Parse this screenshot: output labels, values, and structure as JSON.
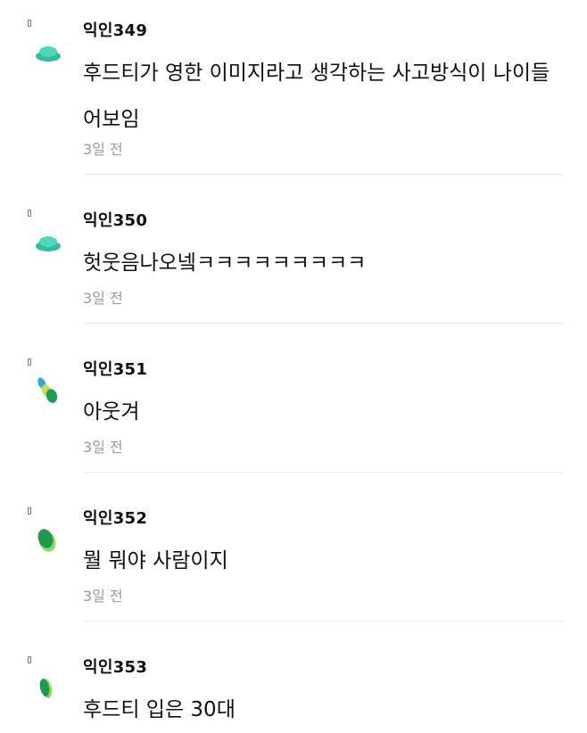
{
  "comments": [
    {
      "author": "익인349",
      "text": "후드티가 영한 이미지라고 생각하는 사고방식이 나이들어보임",
      "time": "3일 전",
      "avatar": "teal-disc-avatar"
    },
    {
      "author": "익인350",
      "text": "헛웃음나오넼ㅋㅋㅋㅋㅋㅋㅋㅋㅋ",
      "time": "3일 전",
      "avatar": "teal-disc-avatar"
    },
    {
      "author": "익인351",
      "text": "아웃겨",
      "time": "3일 전",
      "avatar": "multicolor-blob-avatar"
    },
    {
      "author": "익인352",
      "text": "뭘 뭐야 사람이지",
      "time": "3일 전",
      "avatar": "green-leaf-avatar"
    },
    {
      "author": "익인353",
      "text": "후드티 입은 30대",
      "time": "",
      "avatar": "green-leaf-avatar"
    }
  ]
}
